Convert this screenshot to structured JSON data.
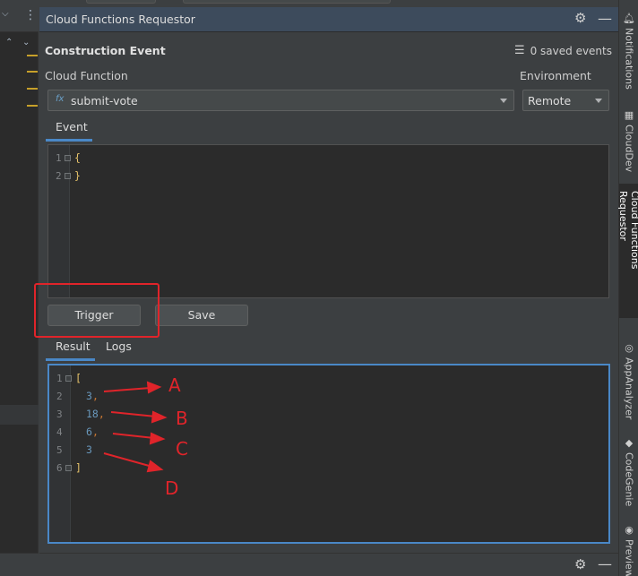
{
  "panel": {
    "title": "Cloud Functions Requestor",
    "section_title": "Construction Event",
    "saved_events": "0 saved events"
  },
  "form": {
    "cloud_function_label": "Cloud Function",
    "cloud_function_value": "submit-vote",
    "cloud_function_prefix": "fx",
    "environment_label": "Environment",
    "environment_value": "Remote"
  },
  "event_tab": {
    "label": "Event"
  },
  "event_editor": {
    "lines": [
      {
        "no": "1",
        "text": "{"
      },
      {
        "no": "2",
        "text": "}"
      }
    ]
  },
  "buttons": {
    "trigger": "Trigger",
    "save": "Save"
  },
  "result_tabs": [
    {
      "label": "Result",
      "active": true
    },
    {
      "label": "Logs",
      "active": false
    }
  ],
  "result_editor": {
    "lines": [
      {
        "no": "1",
        "text": "["
      },
      {
        "no": "2",
        "value": "3",
        "sep": ","
      },
      {
        "no": "3",
        "value": "18",
        "sep": ","
      },
      {
        "no": "4",
        "value": "6",
        "sep": ","
      },
      {
        "no": "5",
        "value": "3",
        "sep": ""
      },
      {
        "no": "6",
        "text": "]"
      }
    ]
  },
  "annotations": {
    "letters": [
      "A",
      "B",
      "C",
      "D"
    ],
    "color": "#e0242a"
  },
  "right_tools": [
    {
      "label": "Notifications",
      "icon": "bell-icon"
    },
    {
      "label": "CloudDev",
      "icon": "grid-icon"
    },
    {
      "label": "Cloud Functions Requestor",
      "icon": "none",
      "active": true
    },
    {
      "label": "AppAnalyzer",
      "icon": "analyzer-icon"
    },
    {
      "label": "CodeGenie",
      "icon": "codegenie-icon"
    },
    {
      "label": "Preview",
      "icon": "eye-icon"
    }
  ],
  "colors": {
    "accent": "#4a88c7",
    "header": "#3d4b5c",
    "annotation": "#e0242a"
  }
}
